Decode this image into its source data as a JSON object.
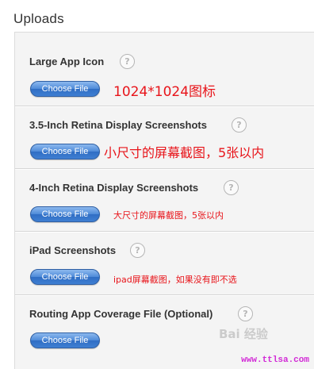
{
  "page": {
    "title": "Uploads"
  },
  "help_icon_glyph": "?",
  "uploads": [
    {
      "label": "Large App Icon",
      "button": "Choose File",
      "note": "1024*1024图标"
    },
    {
      "label": "3.5-Inch Retina Display Screenshots",
      "button": "Choose File",
      "note": "小尺寸的屏幕截图，5张以内"
    },
    {
      "label": "4-Inch Retina Display Screenshots",
      "button": "Choose File",
      "note": "大尺寸的屏幕截图，5张以内"
    },
    {
      "label": "iPad Screenshots",
      "button": "Choose File",
      "note": "ipad屏幕截图，如果没有即不选"
    },
    {
      "label": "Routing App Coverage File (Optional)",
      "button": "Choose File",
      "note": ""
    }
  ],
  "watermark": "Bai 经验",
  "site_url": "www.ttlsa.com",
  "colors": {
    "note_red": "#e8141a",
    "button_blue": "#3f7fd2",
    "url_magenta": "#d22ad6"
  }
}
